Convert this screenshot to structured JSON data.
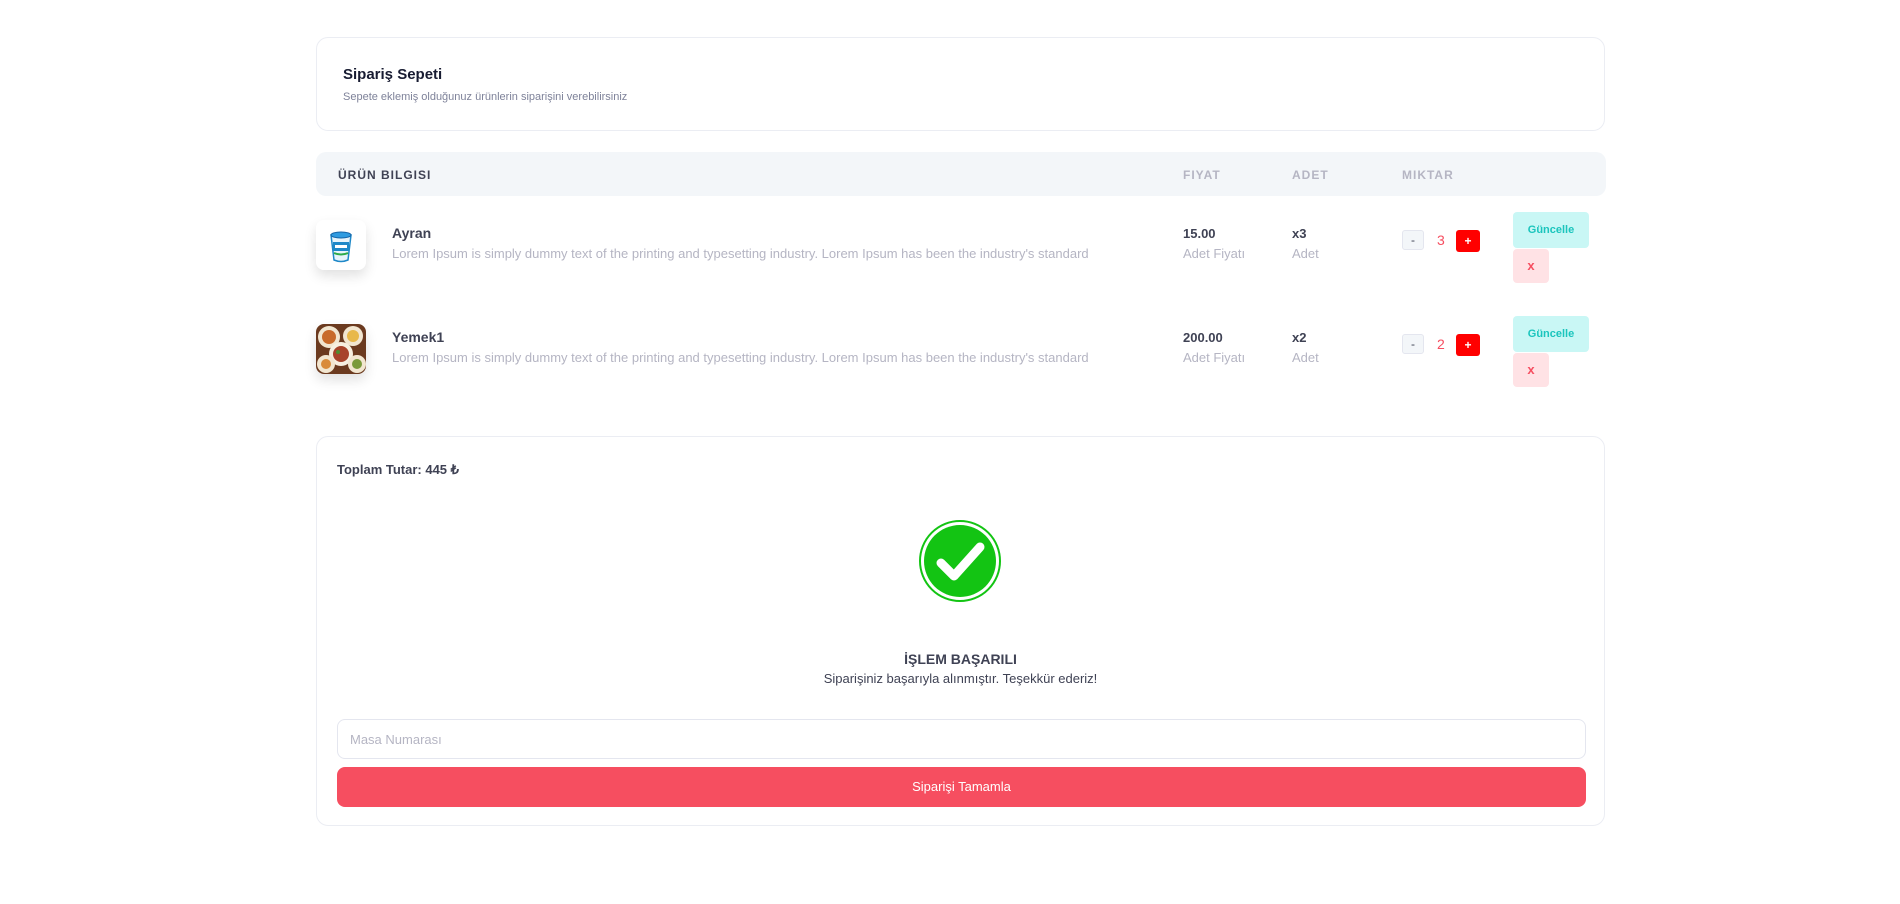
{
  "header": {
    "title": "Sipariş Sepeti",
    "subtitle": "Sepete eklemiş olduğunuz ürünlerin siparişini verebilirsiniz"
  },
  "table": {
    "columns": [
      "ÜRÜN BILGISI",
      "FIYAT",
      "ADET",
      "MIKTAR"
    ],
    "rows": [
      {
        "name": "Ayran",
        "description": "Lorem Ipsum is simply dummy text of the printing and typesetting industry. Lorem Ipsum has been the industry's standard",
        "price": "15.00",
        "price_label": "Adet Fiyatı",
        "qty": "x3",
        "qty_label": "Adet",
        "count": "3",
        "minus": "-",
        "plus": "+",
        "update": "Güncelle",
        "remove": "x",
        "image_icon": "ayran-cup-image"
      },
      {
        "name": "Yemek1",
        "description": "Lorem Ipsum is simply dummy text of the printing and typesetting industry. Lorem Ipsum has been the industry's standard",
        "price": "200.00",
        "price_label": "Adet Fiyatı",
        "qty": "x2",
        "qty_label": "Adet",
        "count": "2",
        "minus": "-",
        "plus": "+",
        "update": "Güncelle",
        "remove": "x",
        "image_icon": "food-platter-image"
      }
    ]
  },
  "order": {
    "total": "Toplam Tutar: 445 ₺",
    "success_icon": "check-circle-icon",
    "success_title": "İŞLEM BAŞARILI",
    "success_message": "Siparişiniz başarıyla alınmıştır. Teşekkür ederiz!",
    "table_placeholder": "Masa Numarası",
    "complete_label": "Siparişi Tamamla"
  },
  "colors": {
    "accent_red": "#f64e60",
    "plus_red": "#ff0000",
    "success_green": "#13c413",
    "update_teal": "#1bc5bd"
  }
}
